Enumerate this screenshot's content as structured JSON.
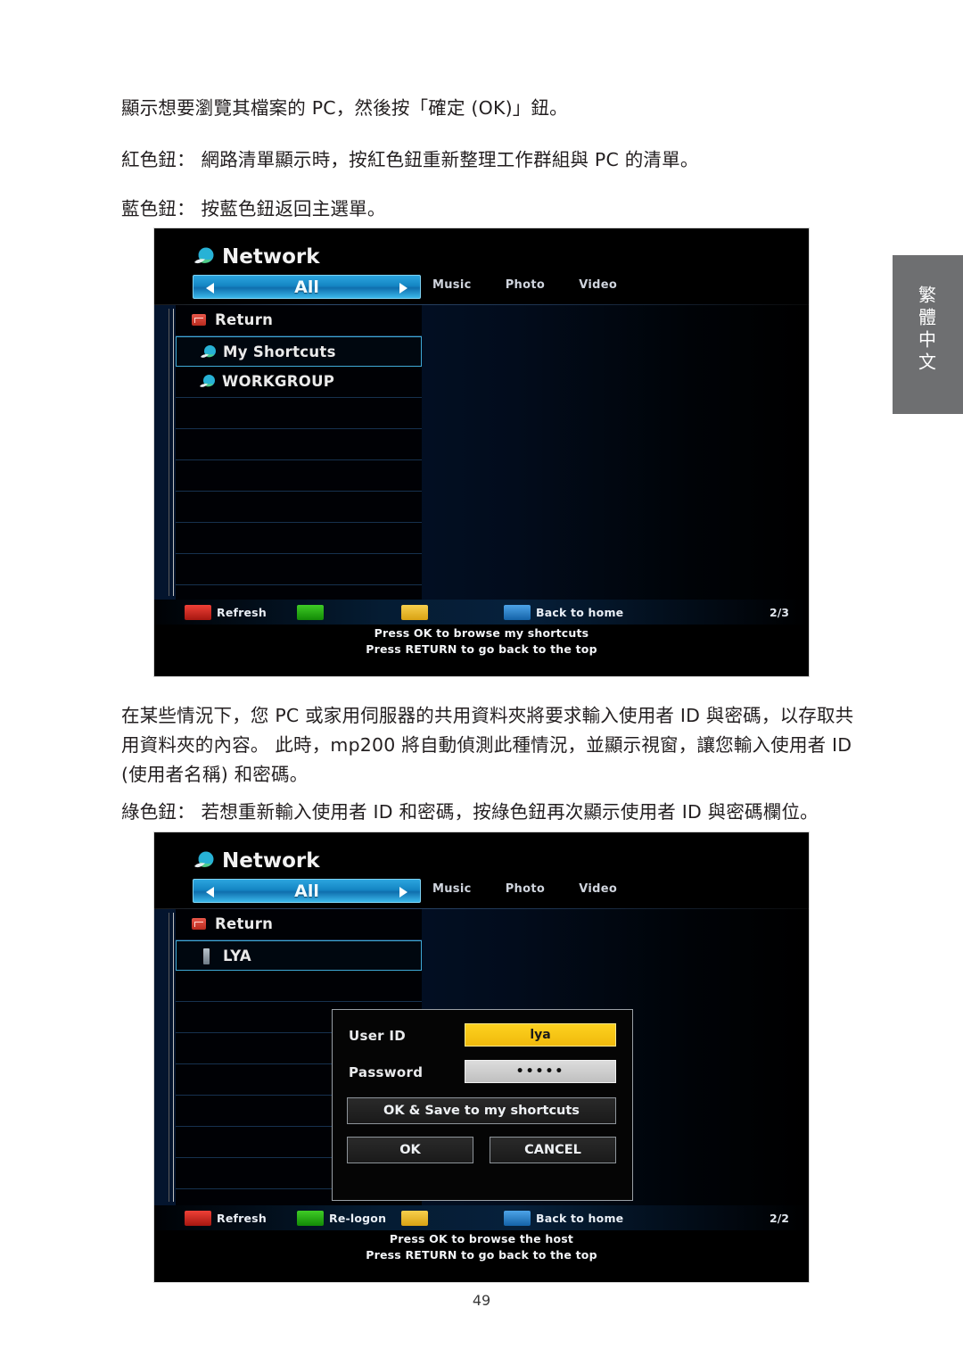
{
  "page": {
    "number": "49",
    "side_tab_label": "繁體中文"
  },
  "body_text": {
    "p1": "顯示想要瀏覽其檔案的 PC，然後按「確定 (OK)」鈕。",
    "p2": "紅色鈕： 網路清單顯示時，按紅色鈕重新整理工作群組與 PC 的清單。",
    "p3": "藍色鈕： 按藍色鈕返回主選單。",
    "p4": "在某些情況下，您 PC 或家用伺服器的共用資料夾將要求輸入使用者 ID 與密碼，以存取共用資料夾的內容。 此時，mp200 將自動偵測此種情況，並顯示視窗，讓您輸入使用者 ID (使用者名稱) 和密碼。",
    "p5": "綠色鈕： 若想重新輸入使用者 ID 和密碼，按綠色鈕再次顯示使用者 ID 與密碼欄位。"
  },
  "screenshot_1": {
    "title": "Network",
    "selector_value": "All",
    "tabs": [
      {
        "label": "Music"
      },
      {
        "label": "Photo"
      },
      {
        "label": "Video"
      }
    ],
    "rows": [
      {
        "label": "Return",
        "icon": "return-icon",
        "selected": false
      },
      {
        "label": "My Shortcuts",
        "icon": "globe-icon",
        "selected": true
      },
      {
        "label": "WORKGROUP",
        "icon": "globe-icon",
        "selected": false
      },
      {
        "label": "",
        "icon": "",
        "selected": false
      },
      {
        "label": "",
        "icon": "",
        "selected": false
      },
      {
        "label": "",
        "icon": "",
        "selected": false
      },
      {
        "label": "",
        "icon": "",
        "selected": false
      },
      {
        "label": "",
        "icon": "",
        "selected": false
      },
      {
        "label": "",
        "icon": "",
        "selected": false
      },
      {
        "label": "",
        "icon": "",
        "selected": false
      }
    ],
    "footer": {
      "red_label": "Refresh",
      "green_label": "",
      "yellow_label": "",
      "blue_label": "Back to home",
      "page_indicator": "2/3",
      "hint_line_1": "Press OK to browse my shortcuts",
      "hint_line_2": "Press RETURN to go back to the top"
    }
  },
  "screenshot_2": {
    "title": "Network",
    "selector_value": "All",
    "tabs": [
      {
        "label": "Music"
      },
      {
        "label": "Photo"
      },
      {
        "label": "Video"
      }
    ],
    "rows": [
      {
        "label": "Return",
        "icon": "return-icon",
        "selected": false
      },
      {
        "label": "LYA",
        "icon": "host-icon",
        "selected": true
      },
      {
        "label": "",
        "icon": "",
        "selected": false
      },
      {
        "label": "",
        "icon": "",
        "selected": false
      },
      {
        "label": "",
        "icon": "",
        "selected": false
      },
      {
        "label": "",
        "icon": "",
        "selected": false
      },
      {
        "label": "",
        "icon": "",
        "selected": false
      },
      {
        "label": "",
        "icon": "",
        "selected": false
      },
      {
        "label": "",
        "icon": "",
        "selected": false
      },
      {
        "label": "",
        "icon": "",
        "selected": false
      }
    ],
    "dialog": {
      "userid_label": "User ID",
      "userid_value": "lya",
      "password_label": "Password",
      "password_value": "•••••",
      "save_button": "OK & Save to my shortcuts",
      "ok_button": "OK",
      "cancel_button": "CANCEL"
    },
    "footer": {
      "red_label": "Refresh",
      "green_label": "Re-logon",
      "yellow_label": "",
      "blue_label": "Back to home",
      "page_indicator": "2/2",
      "hint_line_1": "Press OK to browse the host",
      "hint_line_2": "Press RETURN to go back to the top"
    }
  },
  "colors": {
    "red_key": "#ef4037",
    "green_key": "#3fcc26",
    "yellow_key": "#f6cf4d",
    "blue_key": "#4da4e8",
    "selector_blue": "#1486c4",
    "userid_yellow": "#fdd21f",
    "side_tab_gray": "#6e6f71"
  }
}
